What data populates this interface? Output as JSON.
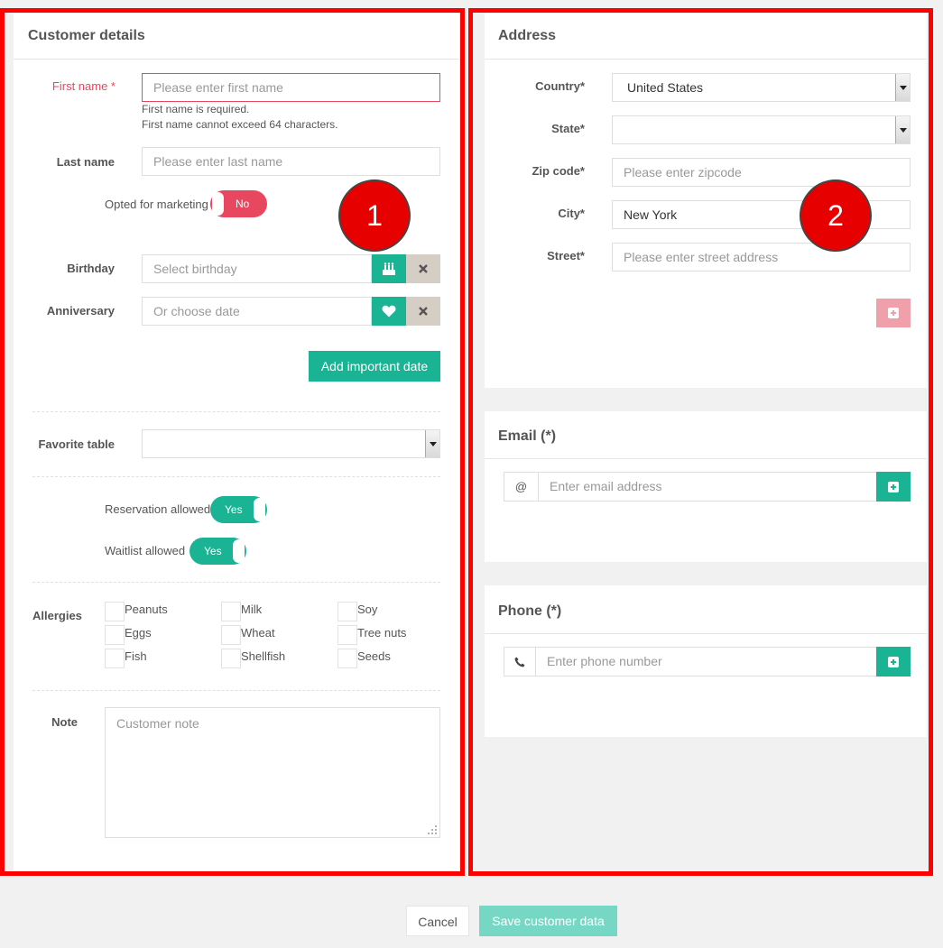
{
  "customer": {
    "title": "Customer details",
    "first_name": {
      "label": "First name *",
      "placeholder": "Please enter first name",
      "errors": [
        "First name is required.",
        "First name cannot exceed 64 characters."
      ]
    },
    "last_name": {
      "label": "Last name",
      "placeholder": "Please enter last name"
    },
    "marketing": {
      "label": "Opted for marketing",
      "state": "No"
    },
    "birthday": {
      "label": "Birthday",
      "placeholder": "Select birthday"
    },
    "anniversary": {
      "label": "Anniversary",
      "placeholder": "Or choose date"
    },
    "add_date_button": "Add important date",
    "favorite_table": {
      "label": "Favorite table",
      "value": ""
    },
    "reservation": {
      "label": "Reservation allowed",
      "state": "Yes"
    },
    "waitlist": {
      "label": "Waitlist allowed",
      "state": "Yes"
    },
    "allergies": {
      "label": "Allergies",
      "items": [
        "Peanuts",
        "Milk",
        "Soy",
        "Eggs",
        "Wheat",
        "Tree nuts",
        "Fish",
        "Shellfish",
        "Seeds"
      ]
    },
    "note": {
      "label": "Note",
      "placeholder": "Customer note"
    }
  },
  "address": {
    "title": "Address",
    "country": {
      "label": "Country*",
      "value": "United States"
    },
    "state": {
      "label": "State*",
      "value": ""
    },
    "zip": {
      "label": "Zip code*",
      "placeholder": "Please enter zipcode"
    },
    "city": {
      "label": "City*",
      "value": "New York"
    },
    "street": {
      "label": "Street*",
      "placeholder": "Please enter street address"
    }
  },
  "email": {
    "title": "Email (*)",
    "addon": "@",
    "placeholder": "Enter email address"
  },
  "phone": {
    "title": "Phone (*)",
    "placeholder": "Enter phone number"
  },
  "footer": {
    "cancel": "Cancel",
    "save": "Save customer data"
  },
  "annotations": {
    "badge1": "1",
    "badge2": "2"
  },
  "colors": {
    "accent": "#1ab394",
    "error": "#e8485f",
    "highlight": "#ff0000"
  }
}
